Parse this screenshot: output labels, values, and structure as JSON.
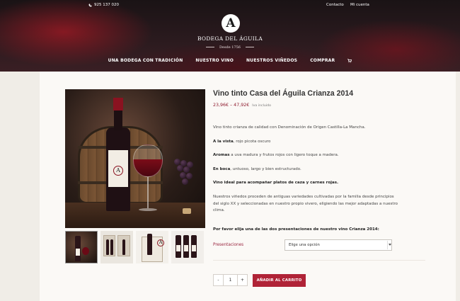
{
  "topbar": {
    "phone": "925 137 020",
    "contact_link": "Contacto",
    "account_link": "Mi cuenta"
  },
  "brand": {
    "logo_letter": "A",
    "name": "BODEGA DEL ÁGUILA",
    "since": "Desde 1756"
  },
  "nav": {
    "items": [
      "UNA BODEGA CON TRADICIÓN",
      "NUESTRO VINO",
      "NUESTROS VIÑEDOS",
      "COMPRAR"
    ],
    "cart_icon": "cart-icon"
  },
  "product": {
    "title": "Vino tinto Casa del Águila Crianza 2014",
    "price_range": "23,96€ – 47,92€",
    "price_note": "Iva incluido",
    "description": {
      "intro": "Vino tinto crianza de calidad con Denominación de Origen Castilla-La Mancha.",
      "vista_label": "A la vista",
      "vista_text": ", rojo picota oscuro",
      "aromas_label": "Aromas",
      "aromas_text": " a uva madura y frutos rojos con ligero toque a madera.",
      "boca_label": "En boca",
      "boca_text": ", untuoso, largo y bien estructurado.",
      "ideal": "Vino ideal para acompañar platos de caza y carnes rojas.",
      "vinedos": "Nuestros viñedos proceden de antiguas variedades cultivadas por la familia desde principios del siglo XX y seleccionadas en nuestro propio vivero, eligiendo las mejor adaptadas a nuestro clima."
    },
    "choose_prompt": "Por favor elija una de las dos presentaciones de nuestro vino Crianza 2014:",
    "variation_label": "Presentaciones",
    "variation_select": "Elige una opción",
    "qty_minus": "-",
    "qty_value": "1",
    "qty_plus": "+",
    "add_to_cart": "AÑADIR AL CARRITO"
  },
  "colors": {
    "accent": "#b02337",
    "price": "#8e1a2e",
    "background": "#f0ede7"
  }
}
